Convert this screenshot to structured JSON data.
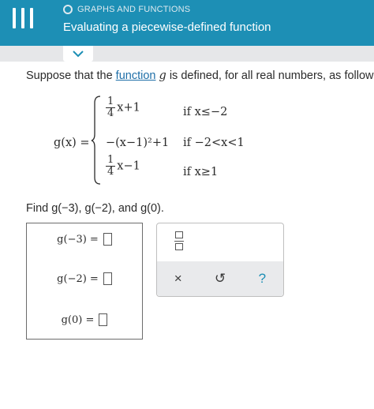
{
  "header": {
    "topic": "GRAPHS AND FUNCTIONS",
    "title": "Evaluating a piecewise-defined function"
  },
  "problem": {
    "prompt_start": "Suppose that the ",
    "prompt_link": "function",
    "prompt_var": "g",
    "prompt_end": " is defined, for all real numbers, as follow",
    "function_name": "g(x) =",
    "cases": [
      {
        "frac_num": "1",
        "frac_den": "4",
        "expr": "x+1",
        "condition": "if x≤−2"
      },
      {
        "expr": "−(x−1)²+1",
        "condition": "if −2<x<1"
      },
      {
        "frac_num": "1",
        "frac_den": "4",
        "expr": "x−1",
        "condition": "if x≥1"
      }
    ],
    "find_text": "Find g(−3), g(−2), and g(0)."
  },
  "answers": [
    {
      "label": "g(−3) ="
    },
    {
      "label": "g(−2) ="
    },
    {
      "label": "g(0) ="
    }
  ],
  "toolbar": {
    "fraction_icon": "fraction-icon",
    "clear_symbol": "×",
    "undo_symbol": "↺",
    "help_symbol": "?"
  }
}
